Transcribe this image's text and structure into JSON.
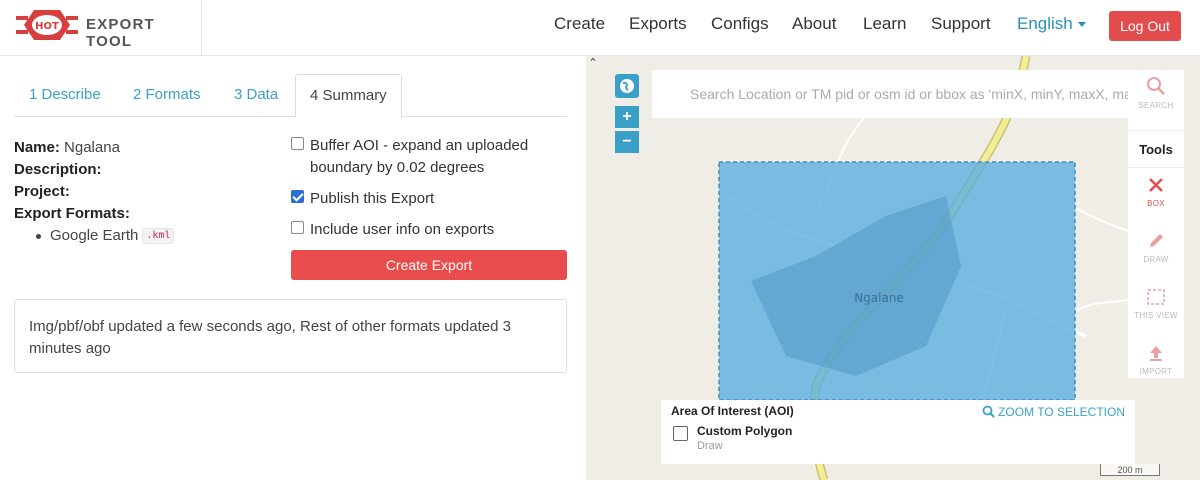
{
  "header": {
    "brand": "EXPORT TOOL",
    "logo_text": "HOT",
    "nav": [
      "Create",
      "Exports",
      "Configs",
      "About",
      "Learn",
      "Support"
    ],
    "language": "English",
    "logout": "Log Out"
  },
  "tabs": [
    "1 Describe",
    "2 Formats",
    "3 Data",
    "4 Summary"
  ],
  "summary": {
    "name_label": "Name:",
    "name_value": "Ngalana",
    "description_label": "Description:",
    "project_label": "Project:",
    "formats_label": "Export Formats:",
    "formats": [
      {
        "name": "Google Earth",
        "ext": ".kml"
      }
    ]
  },
  "options": {
    "buffer_line1": "Buffer AOI - expand an uploaded",
    "buffer_line2": "boundary by 0.02 degrees",
    "buffer_checked": false,
    "publish": "Publish this Export",
    "publish_checked": true,
    "userinfo": "Include user info on exports",
    "userinfo_checked": false
  },
  "create_button": "Create Export",
  "status_message": "Img/pbf/obf updated a few seconds ago, Rest of other formats updated 3 minutes ago",
  "map": {
    "search_placeholder": "Search Location or TM pid or osm id or bbox as 'minX, minY, maxX, maxY'",
    "search_label": "SEARCH",
    "tools_title": "Tools",
    "tools": [
      {
        "label": "BOX",
        "icon": "close-icon",
        "active": true
      },
      {
        "label": "DRAW",
        "icon": "pencil-icon",
        "active": false
      },
      {
        "label": "THIS VIEW",
        "icon": "viewport-icon",
        "active": false
      },
      {
        "label": "IMPORT",
        "icon": "upload-icon",
        "active": false
      }
    ],
    "zoom_in": "+",
    "zoom_out": "−",
    "place_label": "Ngalane",
    "aoi_title": "Area Of Interest (AOI)",
    "zoom_to_selection": "ZOOM TO SELECTION",
    "aoi_name": "Custom Polygon",
    "aoi_sub": "Draw",
    "scale": "200 m"
  },
  "colors": {
    "accent": "#3aa0c8",
    "danger": "#e34c4c",
    "aoi_fill": "#5baee0"
  }
}
